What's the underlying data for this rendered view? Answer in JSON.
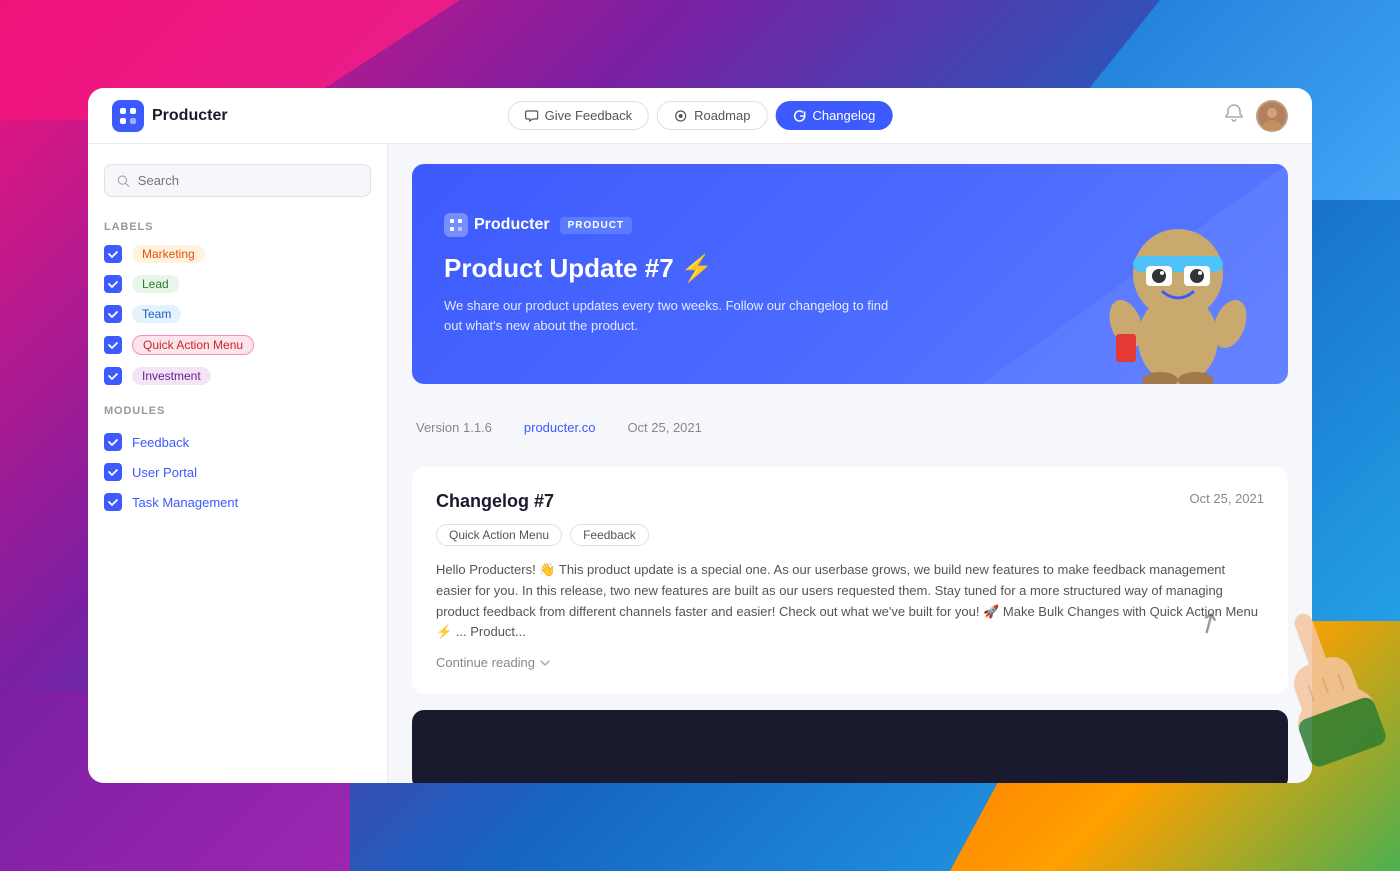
{
  "background": {
    "gradient": "linear-gradient(135deg, #f0147a, #7b1fa2, #1565c0, #29b6f6)"
  },
  "header": {
    "logo_text": "Producter",
    "nav_items": [
      {
        "label": "Give Feedback",
        "icon": "chat-icon",
        "active": false
      },
      {
        "label": "Roadmap",
        "icon": "map-icon",
        "active": false
      },
      {
        "label": "Changelog",
        "icon": "refresh-icon",
        "active": true
      }
    ],
    "notification_icon": "bell-icon",
    "avatar_label": "User"
  },
  "sidebar": {
    "search_placeholder": "Search",
    "labels_section": "LABELS",
    "labels": [
      {
        "name": "Marketing",
        "tag_class": "tag-marketing",
        "checked": true
      },
      {
        "name": "Lead",
        "tag_class": "tag-lead",
        "checked": true
      },
      {
        "name": "Team",
        "tag_class": "tag-team",
        "checked": true
      },
      {
        "name": "Quick Action Menu",
        "tag_class": "tag-quick",
        "checked": true
      },
      {
        "name": "Investment",
        "tag_class": "tag-investment",
        "checked": true
      }
    ],
    "modules_section": "MODULES",
    "modules": [
      {
        "name": "Feedback",
        "checked": true
      },
      {
        "name": "User Portal",
        "checked": true
      },
      {
        "name": "Task Management",
        "checked": true
      }
    ]
  },
  "hero": {
    "logo_text": "Producter",
    "badge": "PRODUCT",
    "title": "Product Update #7 ⚡",
    "description": "We share our product updates every two weeks. Follow our changelog to find out what's new about the product."
  },
  "meta": {
    "version": "Version 1.1.6",
    "website": "producter.co",
    "date": "Oct 25, 2021"
  },
  "changelog_entry": {
    "title": "Changelog #7",
    "date": "Oct 25, 2021",
    "tags": [
      "Quick Action Menu",
      "Feedback"
    ],
    "body": "Hello Producters! 👋 This product update is a special one. As our userbase grows, we build new features to make feedback management easier for you. In this release, two new features are built as our users requested them. Stay tuned for a more structured way of managing product feedback from different channels faster and easier! Check out what we've built for you! 🚀 Make Bulk Changes with Quick Action Menu ⚡ ... Product...",
    "continue_reading": "Continue reading"
  }
}
